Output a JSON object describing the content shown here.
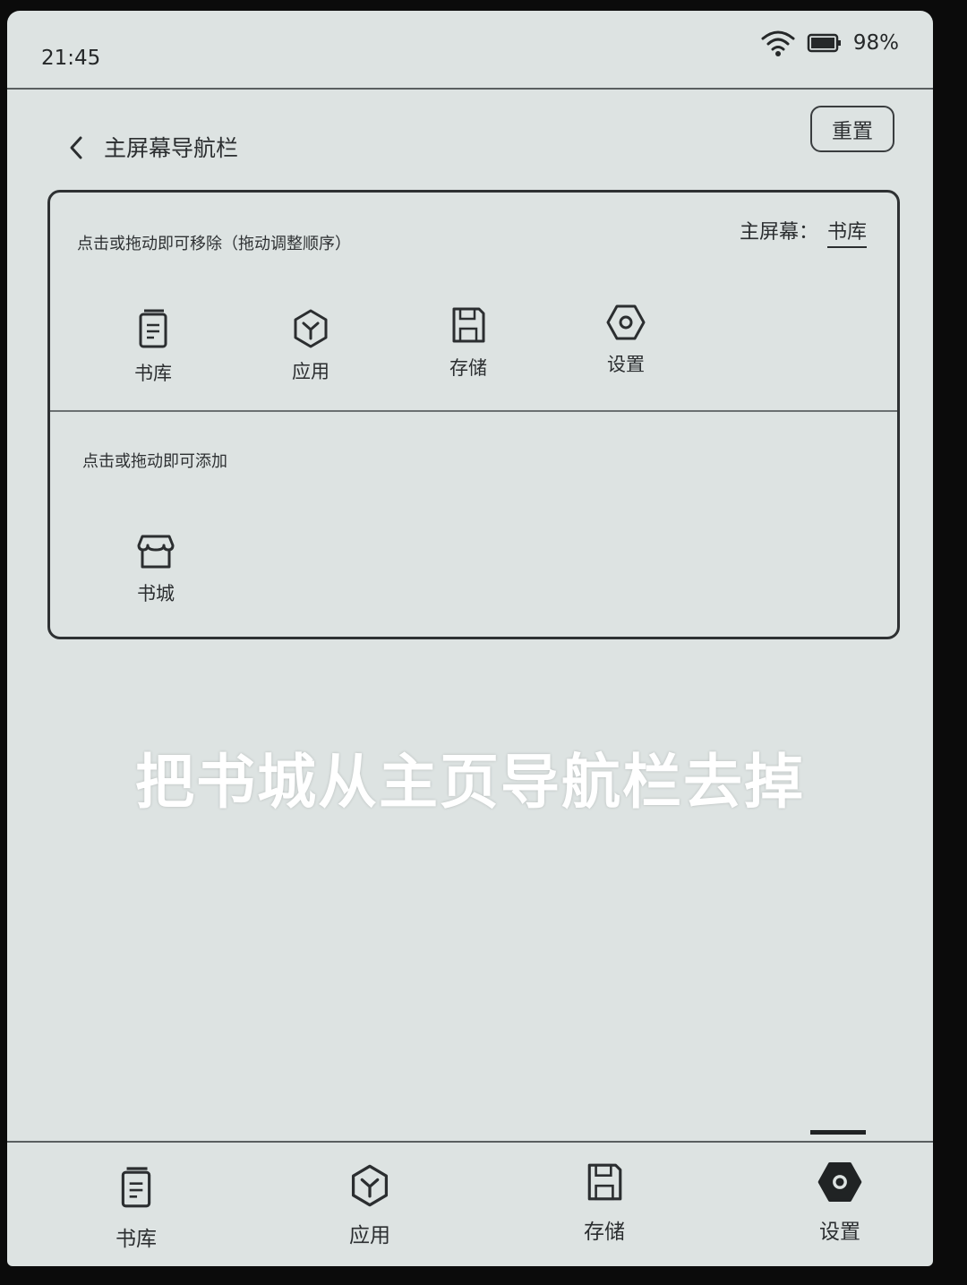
{
  "status_bar": {
    "time": "21:45",
    "wifi_icon": "wifi-icon",
    "battery_icon": "battery-icon",
    "battery_percent": "98%"
  },
  "header": {
    "title": "主屏幕导航栏",
    "back_icon": "chevron-left-icon",
    "reset_label": "重置"
  },
  "panel": {
    "remove_hint": "点击或拖动即可移除（拖动调整顺序）",
    "home_label": "主屏幕：",
    "home_value": "书库",
    "current_items": [
      {
        "label": "书库",
        "icon": "book-icon"
      },
      {
        "label": "应用",
        "icon": "app-cube-icon"
      },
      {
        "label": "存储",
        "icon": "floppy-icon"
      },
      {
        "label": "设置",
        "icon": "hex-gear-icon"
      }
    ],
    "add_hint": "点击或拖动即可添加",
    "available_items": [
      {
        "label": "书城",
        "icon": "store-icon"
      }
    ]
  },
  "caption": "把书城从主页导航栏去掉",
  "bottom_nav": {
    "items": [
      {
        "label": "书库",
        "icon": "book-icon"
      },
      {
        "label": "应用",
        "icon": "app-cube-icon"
      },
      {
        "label": "存储",
        "icon": "floppy-icon"
      },
      {
        "label": "设置",
        "icon": "hex-gear-icon",
        "active": true
      }
    ]
  }
}
